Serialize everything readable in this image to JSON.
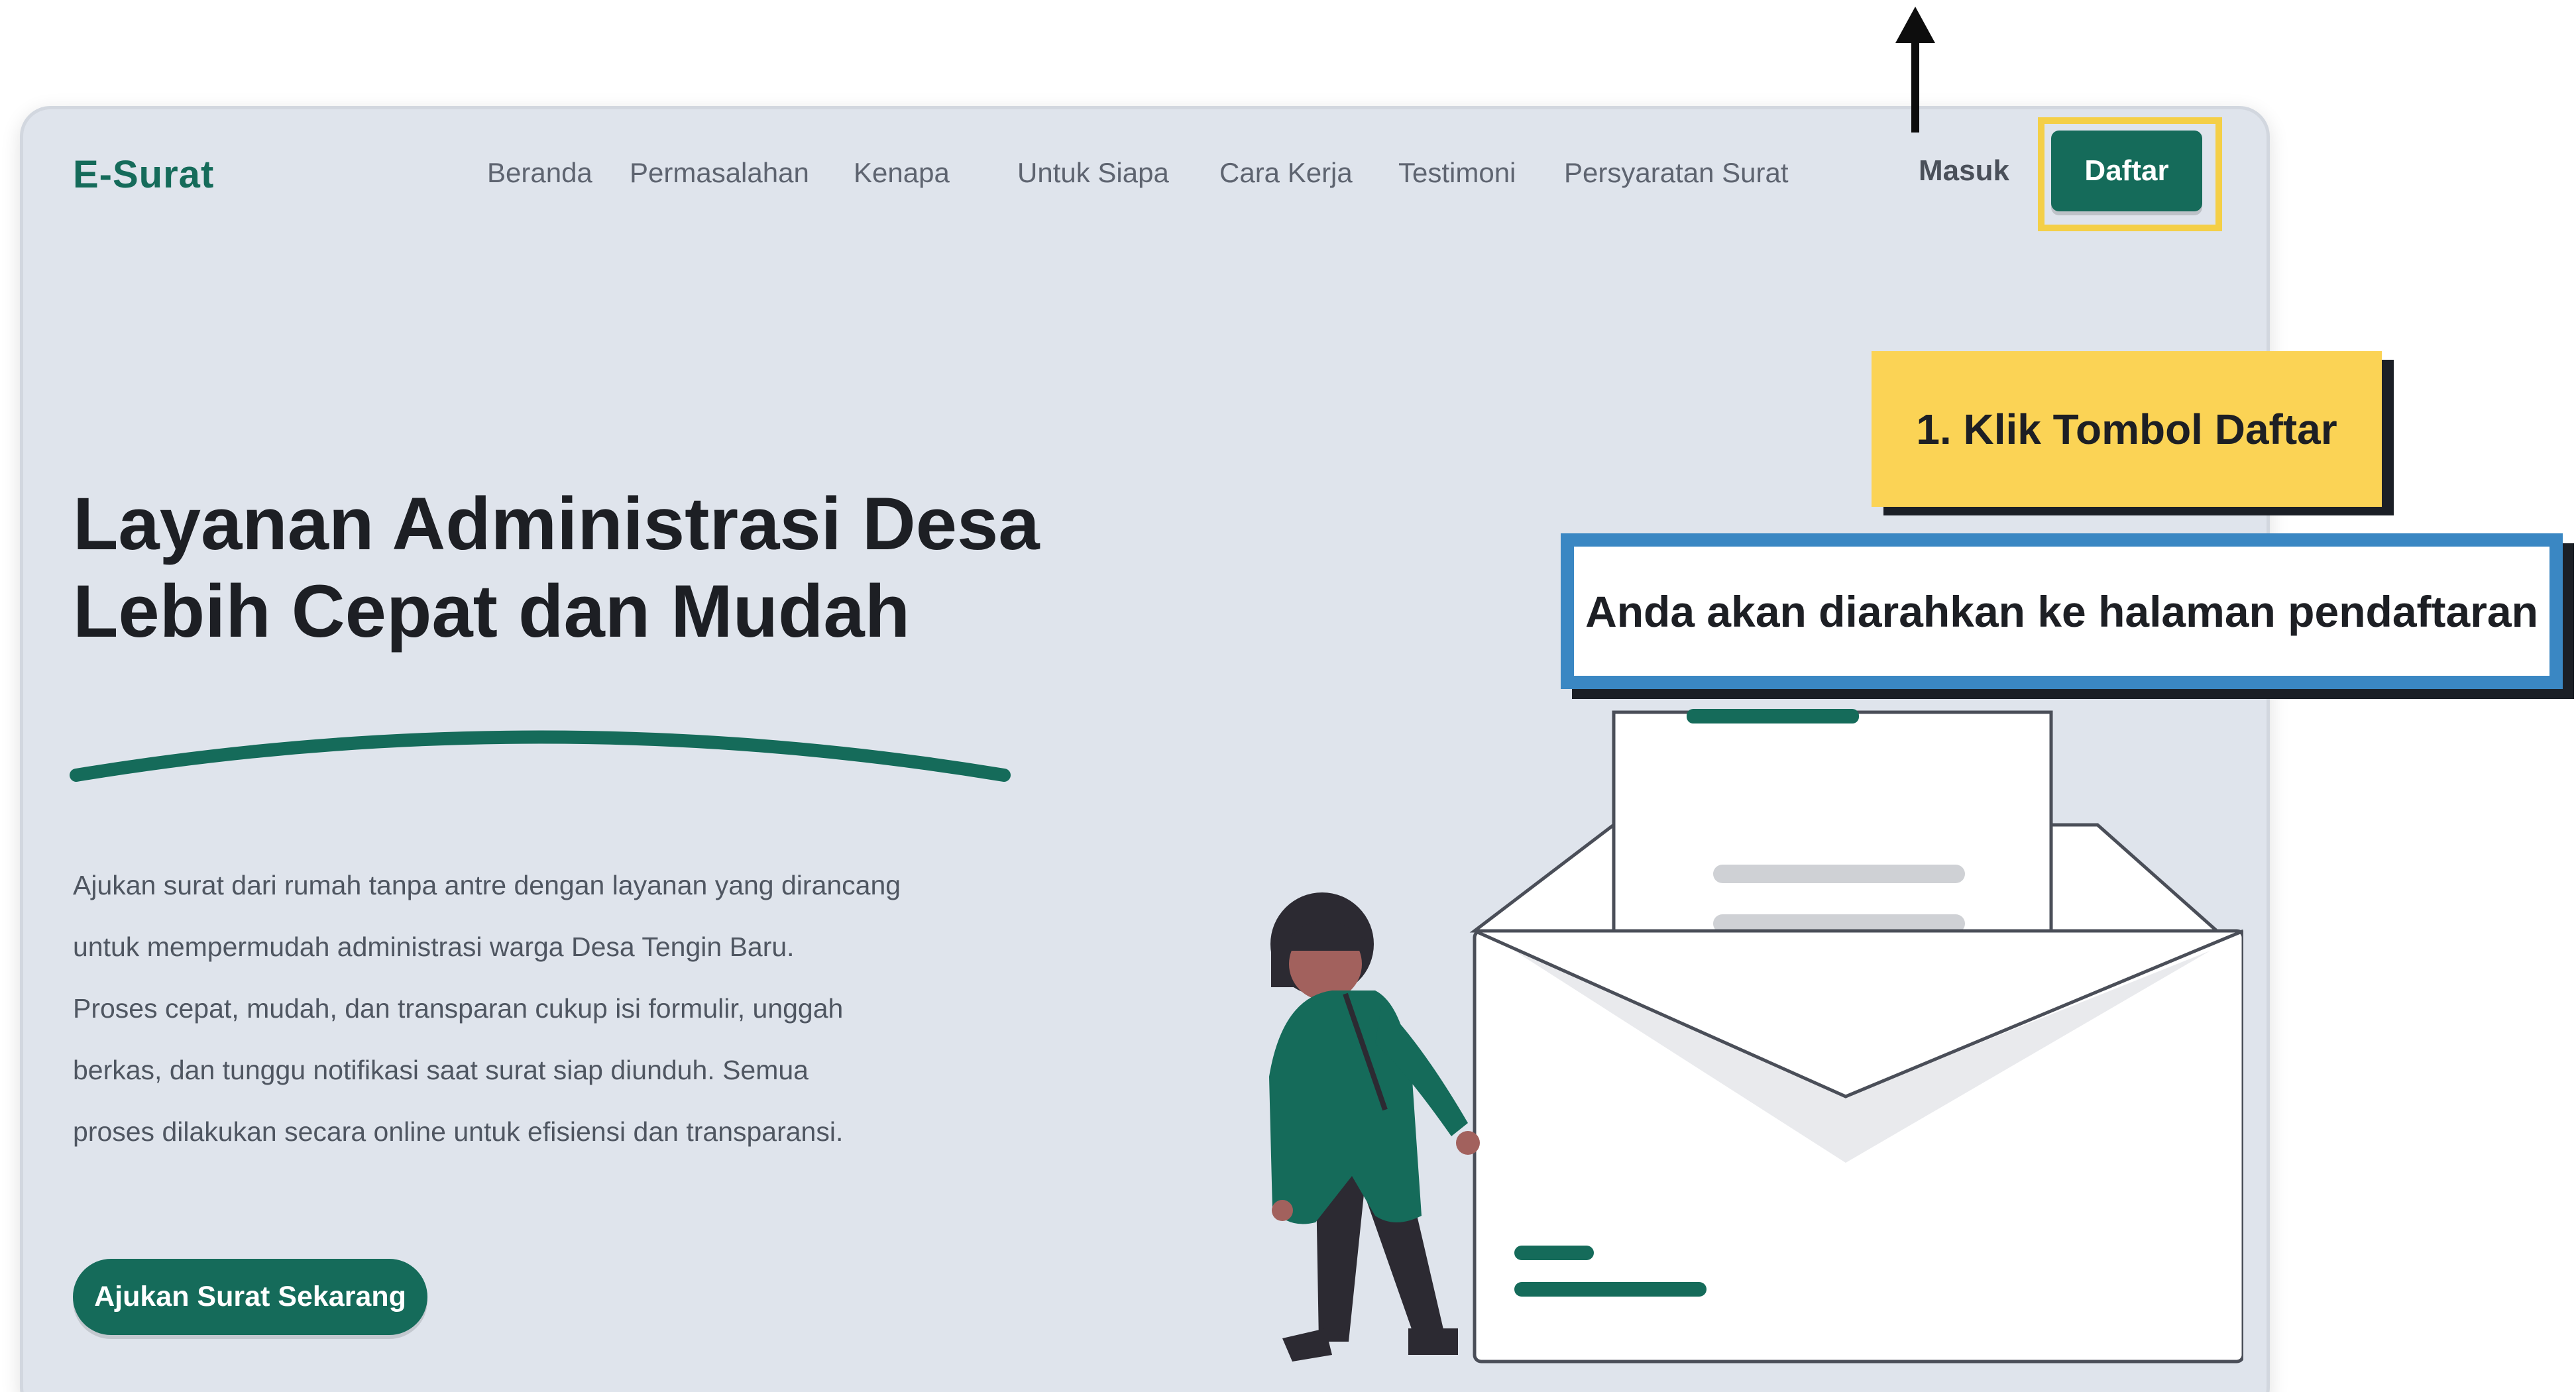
{
  "header": {
    "brand": "E-Surat",
    "nav_items": [
      "Beranda",
      "Permasalahan",
      "Kenapa",
      "Untuk Siapa",
      "Cara Kerja",
      "Testimoni",
      "Persyaratan Surat"
    ],
    "login_label": "Masuk",
    "signup_label": "Daftar"
  },
  "hero": {
    "title_lines": [
      "Layanan Administrasi Desa",
      "Lebih Cepat dan Mudah"
    ],
    "description_lines": [
      "Ajukan surat dari rumah tanpa antre dengan layanan yang dirancang",
      "untuk mempermudah administrasi warga Desa Tengin Baru.",
      "Proses cepat, mudah, dan transparan cukup isi formulir, unggah",
      "berkas, dan tunggu notifikasi saat surat siap diunduh. Semua",
      "proses dilakukan secara online untuk efisiensi dan transparansi."
    ],
    "cta_label": "Ajukan Surat Sekarang"
  },
  "tutorial": {
    "step_label": "1.  Klik Tombol Daftar",
    "info_text": "Anda akan diarahkan ke halaman pendaftaran"
  },
  "colors": {
    "brand_green": "#156b5a",
    "page_background": "#dfe4ec",
    "callout_yellow": "#fbd355",
    "callout_blue": "#3a87c3",
    "highlight_yellow": "#f4cf47"
  },
  "icons": {
    "pointer": "arrow-up-icon",
    "illustration": "woman-with-envelope-illustration"
  }
}
